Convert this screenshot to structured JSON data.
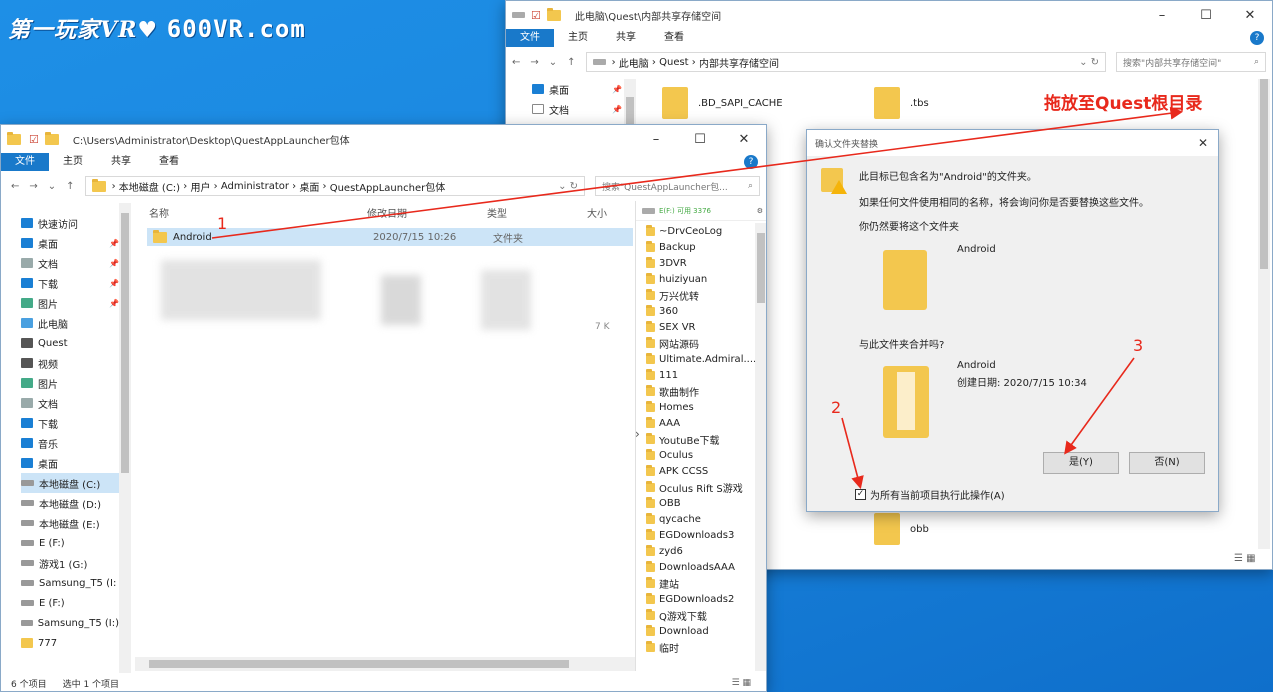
{
  "watermark": {
    "main": "第一玩家VR♥",
    "suffix": "600VR.com"
  },
  "right_window": {
    "title": "此电脑\\Quest\\内部共享存储空间",
    "ribbon": [
      "文件",
      "主页",
      "共享",
      "查看"
    ],
    "path": [
      "此电脑",
      "Quest",
      "内部共享存储空间"
    ],
    "search_placeholder": "搜索\"内部共享存储空间\"",
    "nav": [
      {
        "label": "桌面"
      },
      {
        "label": "文档"
      }
    ],
    "folders": [
      {
        "name": ".BD_SAPI_CACHE"
      },
      {
        "name": ".tbs"
      },
      {
        "name": "obb"
      }
    ],
    "annotation": "拖放至Quest根目录"
  },
  "left_window": {
    "title": "C:\\Users\\Administrator\\Desktop\\QuestAppLauncher包体",
    "ribbon": [
      "文件",
      "主页",
      "共享",
      "查看"
    ],
    "path": [
      "本地磁盘 (C:)",
      "用户",
      "Administrator",
      "桌面",
      "QuestAppLauncher包体"
    ],
    "search_placeholder": "搜索\"QuestAppLauncher包...",
    "nav": [
      {
        "label": "快速访问",
        "icon": "star-icon",
        "pinned": false
      },
      {
        "label": "桌面",
        "icon": "desktop-icon",
        "pinned": true
      },
      {
        "label": "文档",
        "icon": "document-icon",
        "pinned": true
      },
      {
        "label": "下载",
        "icon": "download-icon",
        "pinned": true
      },
      {
        "label": "图片",
        "icon": "picture-icon",
        "pinned": true
      },
      {
        "label": "此电脑",
        "icon": "pc-icon",
        "pinned": false
      },
      {
        "label": "Quest",
        "icon": "quest-icon",
        "pinned": false
      },
      {
        "label": "视频",
        "icon": "video-icon",
        "pinned": false
      },
      {
        "label": "图片",
        "icon": "picture-icon",
        "pinned": false
      },
      {
        "label": "文档",
        "icon": "document-icon",
        "pinned": false
      },
      {
        "label": "下载",
        "icon": "download-icon",
        "pinned": false
      },
      {
        "label": "音乐",
        "icon": "music-icon",
        "pinned": false
      },
      {
        "label": "桌面",
        "icon": "desktop-icon",
        "pinned": false
      },
      {
        "label": "本地磁盘 (C:)",
        "icon": "drive-icon",
        "pinned": false,
        "selected": true
      },
      {
        "label": "本地磁盘 (D:)",
        "icon": "drive-icon",
        "pinned": false
      },
      {
        "label": "本地磁盘 (E:)",
        "icon": "drive-icon",
        "pinned": false
      },
      {
        "label": "E (F:)",
        "icon": "drive-icon",
        "pinned": false
      },
      {
        "label": "游戏1 (G:)",
        "icon": "drive-icon",
        "pinned": false
      },
      {
        "label": "Samsung_T5 (I:",
        "icon": "drive-icon",
        "pinned": false
      },
      {
        "label": "E (F:)",
        "icon": "drive-icon",
        "pinned": false
      },
      {
        "label": "Samsung_T5 (I:)",
        "icon": "drive-icon",
        "pinned": false
      },
      {
        "label": "777",
        "icon": "folder-icon",
        "pinned": false
      }
    ],
    "columns": [
      "名称",
      "修改日期",
      "类型",
      "大小"
    ],
    "row": {
      "name": "Android",
      "date": "2020/7/15 10:26",
      "type": "文件夹",
      "size": ""
    },
    "status_count": "6 个项目",
    "status_selected": "选中 1 个项目",
    "marker": "1",
    "blurred_size": "7 K"
  },
  "mini_panel": {
    "header": "E(F:) 可用 3376",
    "items": [
      "~DrvCeoLog",
      "Backup",
      "3DVR",
      "huiziyuan",
      "万兴优转",
      "360",
      "SEX VR",
      "网站源码",
      "Ultimate.Admiral....",
      "111",
      "歌曲制作",
      "Homes",
      "AAA",
      "YoutuBe下载",
      "Oculus",
      "APK CCSS",
      "Oculus Rift S游戏",
      "OBB",
      "qycache",
      "EGDownloads3",
      "zyd6",
      "DownloadsAAA",
      "建站",
      "EGDownloads2",
      "Q游戏下载",
      "Download",
      "临时"
    ]
  },
  "dialog": {
    "title": "确认文件夹替换",
    "line1": "此目标已包含名为\"Android\"的文件夹。",
    "line2": "如果任何文件使用相同的名称，将会询问你是否要替换这些文件。",
    "line3": "你仍然要将这个文件夹",
    "folder1": "Android",
    "merge_q": "与此文件夹合并吗?",
    "folder2": "Android",
    "created": "创建日期: 2020/7/15 10:34",
    "yes": "是(Y)",
    "no": "否(N)",
    "checkbox": "为所有当前项目执行此操作(A)",
    "marker2": "2",
    "marker3": "3"
  },
  "colors": {
    "accent": "#1979ca",
    "annotation": "#e8291c",
    "folder": "#f3c74e",
    "selection": "#cce4f7"
  }
}
